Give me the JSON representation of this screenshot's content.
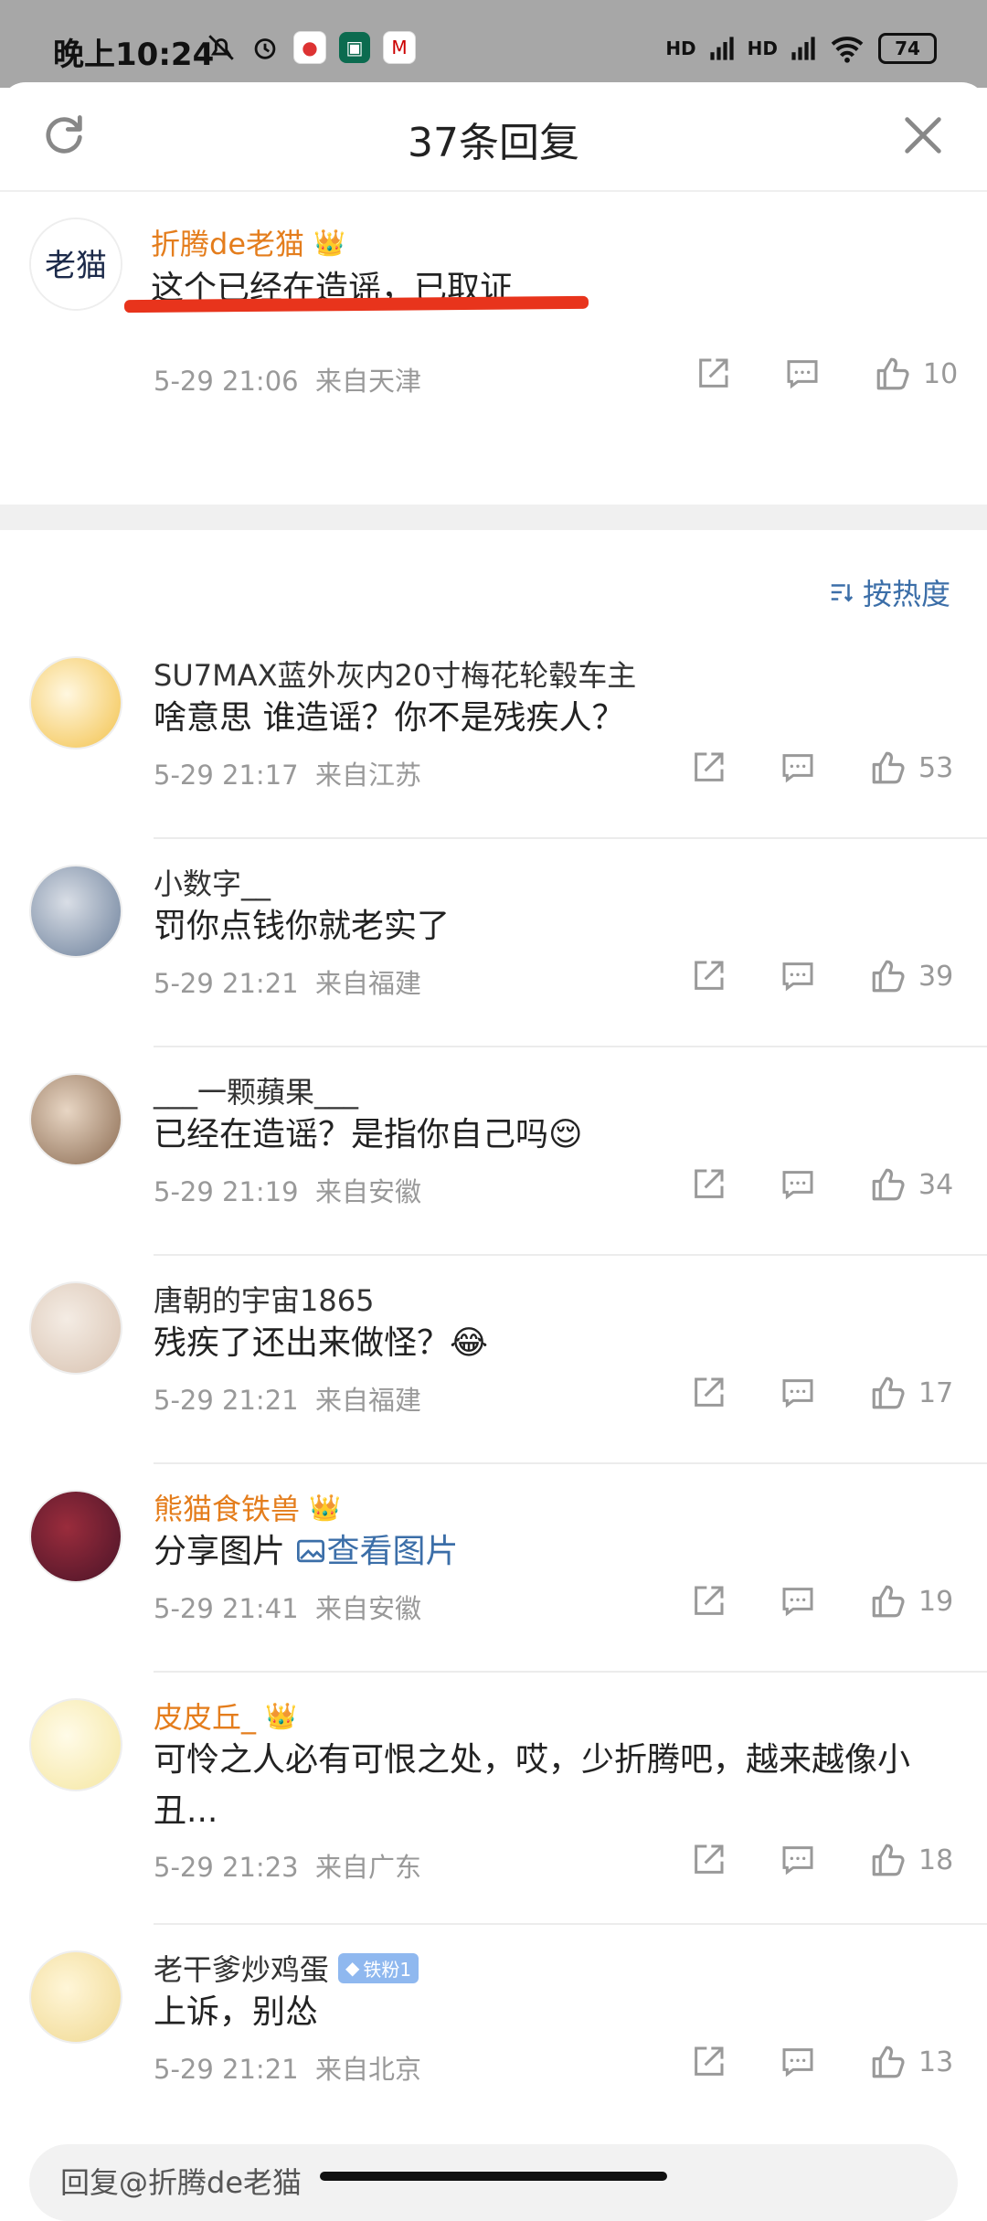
{
  "status": {
    "time": "晚上10:24",
    "battery": "74",
    "signal1": "HD",
    "signal2": "HD"
  },
  "header": {
    "title": "37条回复"
  },
  "original": {
    "username": "折腾de老猫",
    "text": "这个已经在造谣，已取证",
    "time": "5-29 21:06",
    "location": "来自天津",
    "likes": "10"
  },
  "sort_label": "按热度",
  "replies": [
    {
      "username": "SU7MAX蓝外灰内20寸梅花轮毂车主",
      "text": "啥意思 谁造谣？你不是残疾人？",
      "time": "5-29 21:17",
      "location": "来自江苏",
      "likes": "53"
    },
    {
      "username": "小数字__",
      "text": "罚你点钱你就老实了",
      "time": "5-29 21:21",
      "location": "来自福建",
      "likes": "39"
    },
    {
      "username": "___一颗蘋果___",
      "text": "已经在造谣？是指你自己吗😌",
      "time": "5-29 21:19",
      "location": "来自安徽",
      "likes": "34"
    },
    {
      "username": "唐朝的宇宙1865",
      "text": "残疾了还出来做怪？😂",
      "time": "5-29 21:21",
      "location": "来自福建",
      "likes": "17"
    },
    {
      "username": "熊猫食铁兽",
      "text": "分享图片 ",
      "link": "查看图片",
      "time": "5-29 21:41",
      "location": "来自安徽",
      "likes": "19"
    },
    {
      "username": "皮皮丘_",
      "text": "可怜之人必有可恨之处，哎，少折腾吧，越来越像小丑...",
      "time": "5-29 21:23",
      "location": "来自广东",
      "likes": "18"
    },
    {
      "username": "老干爹炒鸡蛋",
      "badge": "铁粉1",
      "text": "上诉，别怂",
      "time": "5-29 21:21",
      "location": "来自北京",
      "likes": "13"
    }
  ],
  "reply_input": {
    "placeholder": "回复@折腾de老猫"
  },
  "colors": {
    "vip_name": "#e47d1c",
    "link": "#3b6ea8",
    "annotation": "#e8341c"
  }
}
